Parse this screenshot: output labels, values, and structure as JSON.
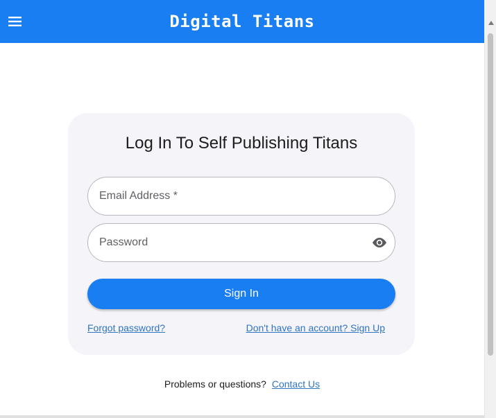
{
  "header": {
    "title": "Digital Titans",
    "menu_icon": "hamburger-menu-icon",
    "background": "#1a7ef3"
  },
  "login": {
    "title": "Log In To Self Publishing Titans",
    "email": {
      "placeholder": "Email Address *",
      "value": ""
    },
    "password": {
      "placeholder": "Password",
      "value": "",
      "toggle_icon": "eye-icon"
    },
    "sign_in_label": "Sign In",
    "forgot_password_label": "Forgot password?",
    "sign_up_label": "Don't have an account? Sign Up"
  },
  "footer": {
    "text": "Problems or questions?",
    "contact_label": "Contact Us"
  },
  "colors": {
    "accent": "#1a7ef3",
    "link": "#2f74c0",
    "card": "#f5f4f8"
  }
}
